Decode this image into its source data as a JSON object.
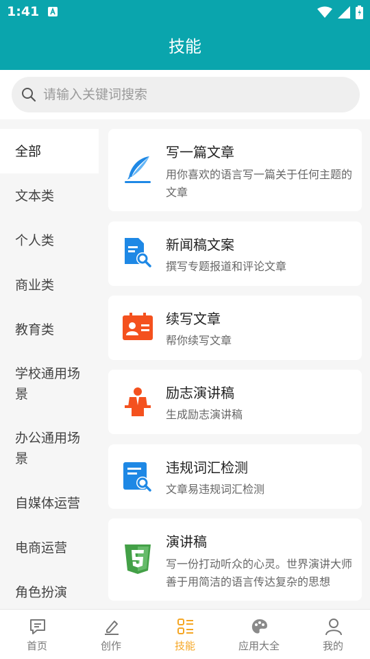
{
  "status_bar": {
    "time": "1:41"
  },
  "app_bar": {
    "title": "技能"
  },
  "search": {
    "placeholder": "请输入关键词搜索"
  },
  "categories": [
    {
      "label": "全部",
      "active": true
    },
    {
      "label": "文本类"
    },
    {
      "label": "个人类"
    },
    {
      "label": "商业类"
    },
    {
      "label": "教育类"
    },
    {
      "label": "学校通用场景"
    },
    {
      "label": "办公通用场景"
    },
    {
      "label": "自媒体运营"
    },
    {
      "label": "电商运营"
    },
    {
      "label": "角色扮演"
    }
  ],
  "skills": [
    {
      "title": "写一篇文章",
      "desc": "用你喜欢的语言写一篇关于任何主题的文章",
      "icon": "quill-feather-icon",
      "color": "#1e88e5"
    },
    {
      "title": "新闻稿文案",
      "desc": "撰写专题报道和评论文章",
      "icon": "document-search-icon",
      "color": "#1e88e5"
    },
    {
      "title": "续写文章",
      "desc": "帮你续写文章",
      "icon": "contact-card-icon",
      "color": "#f4511e"
    },
    {
      "title": "励志演讲稿",
      "desc": "生成励志演讲稿",
      "icon": "speaker-person-icon",
      "color": "#f4511e"
    },
    {
      "title": "违规词汇检测",
      "desc": "文章易违规词汇检测",
      "icon": "file-inspect-icon",
      "color": "#1e88e5"
    },
    {
      "title": "演讲稿",
      "desc": "写一份打动听众的心灵。世界演讲大师善于用简洁的语言传达复杂的思想",
      "icon": "html5-shield-icon",
      "color": "#43a047"
    }
  ],
  "bottom_nav": [
    {
      "label": "首页",
      "icon": "chat-bubble-icon"
    },
    {
      "label": "创作",
      "icon": "pencil-icon"
    },
    {
      "label": "技能",
      "icon": "skills-list-icon",
      "active": true
    },
    {
      "label": "应用大全",
      "icon": "palette-icon"
    },
    {
      "label": "我的",
      "icon": "user-icon"
    }
  ],
  "colors": {
    "primary": "#0aa5ad",
    "active_tab": "#f5a623"
  }
}
